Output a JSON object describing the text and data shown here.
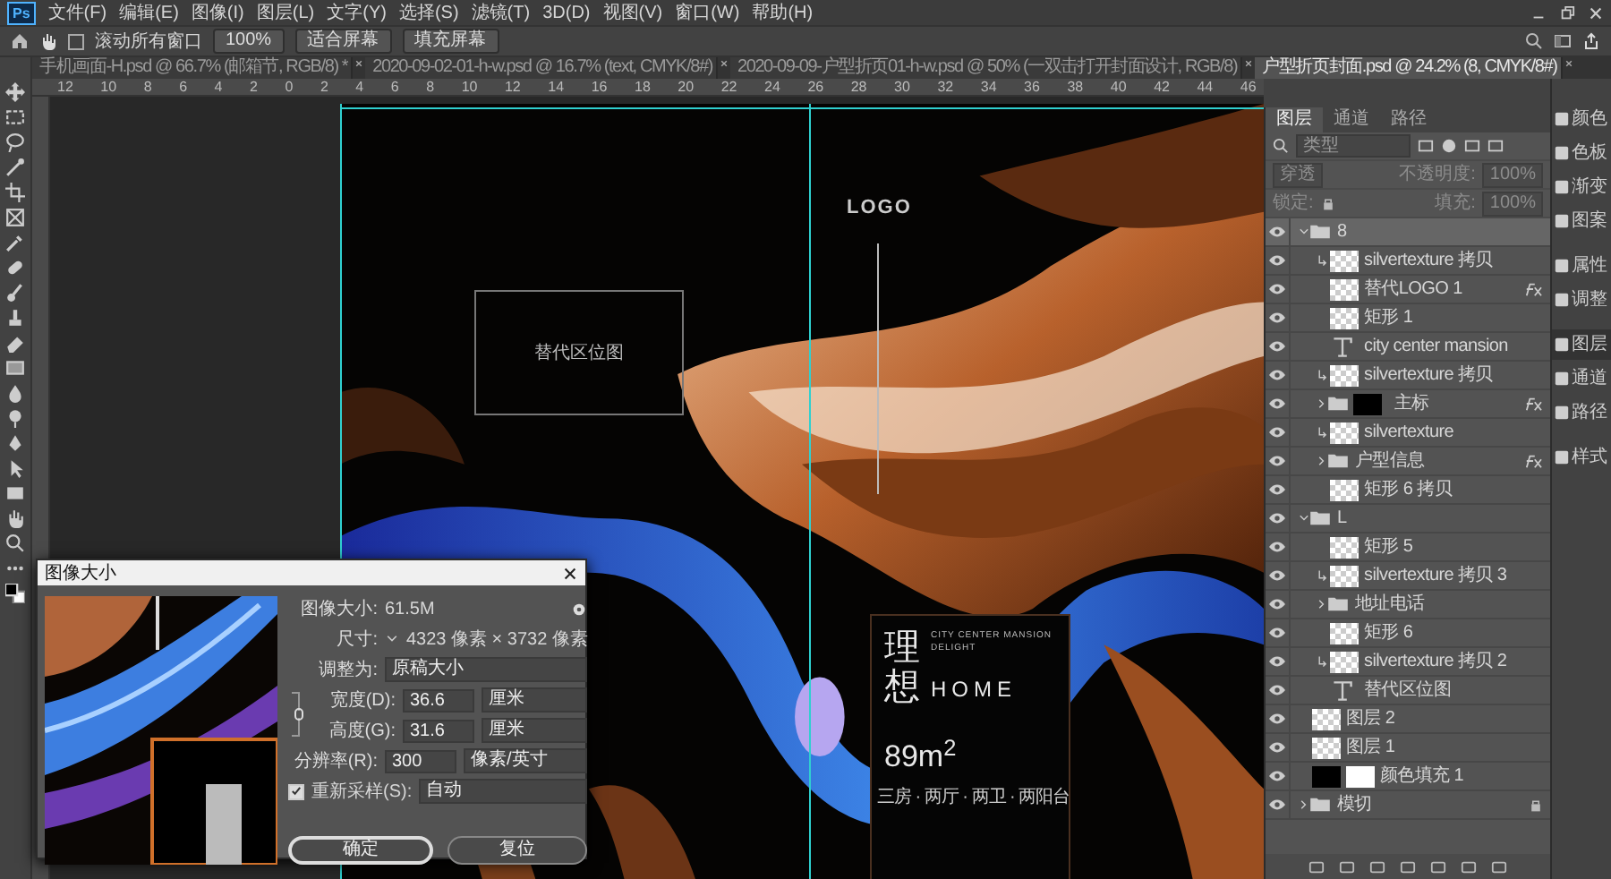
{
  "app": {
    "logo": "Ps"
  },
  "menu": [
    "文件(F)",
    "编辑(E)",
    "图像(I)",
    "图层(L)",
    "文字(Y)",
    "选择(S)",
    "滤镜(T)",
    "3D(D)",
    "视图(V)",
    "窗口(W)",
    "帮助(H)"
  ],
  "options_bar": {
    "scroll_all": {
      "label": "滚动所有窗口",
      "checked": false
    },
    "buttons": [
      "100%",
      "适合屏幕",
      "填充屏幕"
    ]
  },
  "tabs": [
    {
      "label": "手机画面-H.psd @ 66.7% (邮箱节, RGB/8) *",
      "selected": false
    },
    {
      "label": "2020-09-02-01-h-w.psd @ 16.7% (text, CMYK/8#)",
      "selected": false
    },
    {
      "label": "2020-09-09-户型折页01-h-w.psd @ 50% (一双击打开封面设计, RGB/8)",
      "selected": false
    },
    {
      "label": "户型折页封面.psd @ 24.2% (8, CMYK/8#)",
      "selected": true
    }
  ],
  "ruler": [
    "12",
    "10",
    "8",
    "6",
    "4",
    "2",
    "0",
    "2",
    "4",
    "6",
    "8",
    "10",
    "12",
    "14",
    "16",
    "18",
    "20",
    "22",
    "24",
    "26",
    "28",
    "30",
    "32",
    "34",
    "36",
    "38",
    "40",
    "42",
    "44",
    "46"
  ],
  "document": {
    "logo": "LOGO",
    "map_placeholder": "替代区位图",
    "title": "理想",
    "subtitle": [
      "CITY CENTER MANSION",
      "DELIGHT"
    ],
    "home": "HOME",
    "area": "89m$^{2}$",
    "layout": "三房 · 两厅 · 两卫 · 两阳台"
  },
  "dialog": {
    "title": "图像大小",
    "size": {
      "label": "图像大小:",
      "value": "61.5M"
    },
    "dimensions": {
      "label": "尺寸:",
      "value": "4323 像素 × 3732 像素"
    },
    "fit_to": {
      "label": "调整为:",
      "value": "原稿大小"
    },
    "fields": [
      {
        "label": "宽度(D):",
        "value": "36.6",
        "unit": "厘米"
      },
      {
        "label": "高度(G):",
        "value": "31.6",
        "unit": "厘米"
      },
      {
        "label": "分辨率(R):",
        "value": "300",
        "unit": "像素/英寸"
      }
    ],
    "resample": {
      "label": "重新采样(S):",
      "checked": true,
      "value": "自动"
    },
    "buttons": [
      {
        "label": "确定",
        "primary": true
      },
      {
        "label": "复位",
        "primary": false
      }
    ]
  },
  "layers_panel": {
    "tabs": [
      {
        "label": "图层",
        "selected": true
      },
      {
        "label": "通道",
        "selected": false
      },
      {
        "label": "路径",
        "selected": false
      }
    ],
    "filter": {
      "placeholder": "类型"
    },
    "blend_mode": "穿透",
    "opacity_label": "不透明度:",
    "opacity": "100%",
    "lock_label": "锁定:",
    "fill_label": "填充:",
    "fill": "100%",
    "layers": [
      {
        "name": "8",
        "kind": "group",
        "visible": true,
        "selected": true,
        "expanded": true,
        "children": [
          {
            "name": "silvertexture 拷贝",
            "kind": "smart",
            "visible": true,
            "selected": false,
            "clipped": true
          },
          {
            "name": "替代LOGO 1",
            "kind": "shape",
            "visible": true,
            "selected": false,
            "fx": true
          },
          {
            "name": "矩形 1",
            "kind": "shape",
            "visible": true,
            "selected": false
          },
          {
            "name": "city center mansion",
            "kind": "text",
            "visible": true,
            "selected": false
          },
          {
            "name": "silvertexture 拷贝",
            "kind": "smart",
            "visible": true,
            "selected": false,
            "clipped": true
          },
          {
            "name": "主标",
            "kind": "group",
            "visible": true,
            "selected": false,
            "expanded": false,
            "mask": true,
            "fx": true
          },
          {
            "name": "silvertexture",
            "kind": "smart",
            "visible": true,
            "selected": false,
            "clipped": true
          },
          {
            "name": "户型信息",
            "kind": "group",
            "visible": true,
            "selected": false,
            "expanded": false,
            "fx": true
          },
          {
            "name": "矩形 6 拷贝",
            "kind": "shape",
            "visible": true,
            "selected": false
          }
        ]
      },
      {
        "name": "L",
        "kind": "group",
        "visible": true,
        "selected": false,
        "expanded": true,
        "children": [
          {
            "name": "矩形 5",
            "kind": "shape",
            "visible": true,
            "selected": false
          },
          {
            "name": "silvertexture 拷贝 3",
            "kind": "smart",
            "visible": true,
            "selected": false,
            "clipped": true
          },
          {
            "name": "地址电话",
            "kind": "group",
            "visible": true,
            "selected": false,
            "expanded": false
          },
          {
            "name": "矩形 6",
            "kind": "shape",
            "visible": true,
            "selected": false
          },
          {
            "name": "silvertexture 拷贝 2",
            "kind": "smart",
            "visible": true,
            "selected": false,
            "clipped": true
          },
          {
            "name": "替代区位图",
            "kind": "text",
            "visible": true,
            "selected": false
          }
        ]
      },
      {
        "name": "图层 2",
        "kind": "pixel",
        "visible": true,
        "selected": false
      },
      {
        "name": "图层 1",
        "kind": "pixel",
        "visible": true,
        "selected": false
      },
      {
        "name": "颜色填充 1",
        "kind": "fill",
        "visible": true,
        "selected": false,
        "mask": true
      },
      {
        "name": "模切",
        "kind": "group",
        "visible": true,
        "selected": false,
        "expanded": false,
        "locked": true
      }
    ]
  },
  "dock": [
    {
      "label": "颜色",
      "selected": false
    },
    {
      "label": "色板",
      "selected": false
    },
    {
      "label": "渐变",
      "selected": false
    },
    {
      "label": "图案",
      "selected": false
    },
    {
      "label": "属性",
      "selected": false
    },
    {
      "label": "调整",
      "selected": false
    },
    {
      "label": "图层",
      "selected": true
    },
    {
      "label": "通道",
      "selected": false
    },
    {
      "label": "路径",
      "selected": false
    },
    {
      "label": "样式",
      "selected": false
    }
  ]
}
